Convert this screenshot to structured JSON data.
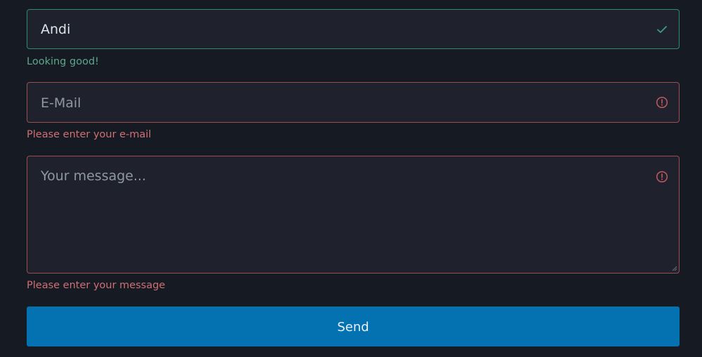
{
  "form": {
    "name": {
      "value": "Andi",
      "status": "valid",
      "feedback": "Looking good!",
      "icon": "check-icon"
    },
    "email": {
      "placeholder": "E-Mail",
      "status": "invalid",
      "feedback": "Please enter your e-mail",
      "icon": "alert-circle-icon"
    },
    "message": {
      "placeholder": "Your message...",
      "status": "invalid",
      "feedback": "Please enter your message",
      "icon": "alert-circle-icon"
    },
    "submit_label": "Send"
  },
  "colors": {
    "background": "#161a23",
    "field_background": "#1f222d",
    "valid": "#2f8a72",
    "invalid": "#9a4e52",
    "button": "#0471b1"
  }
}
